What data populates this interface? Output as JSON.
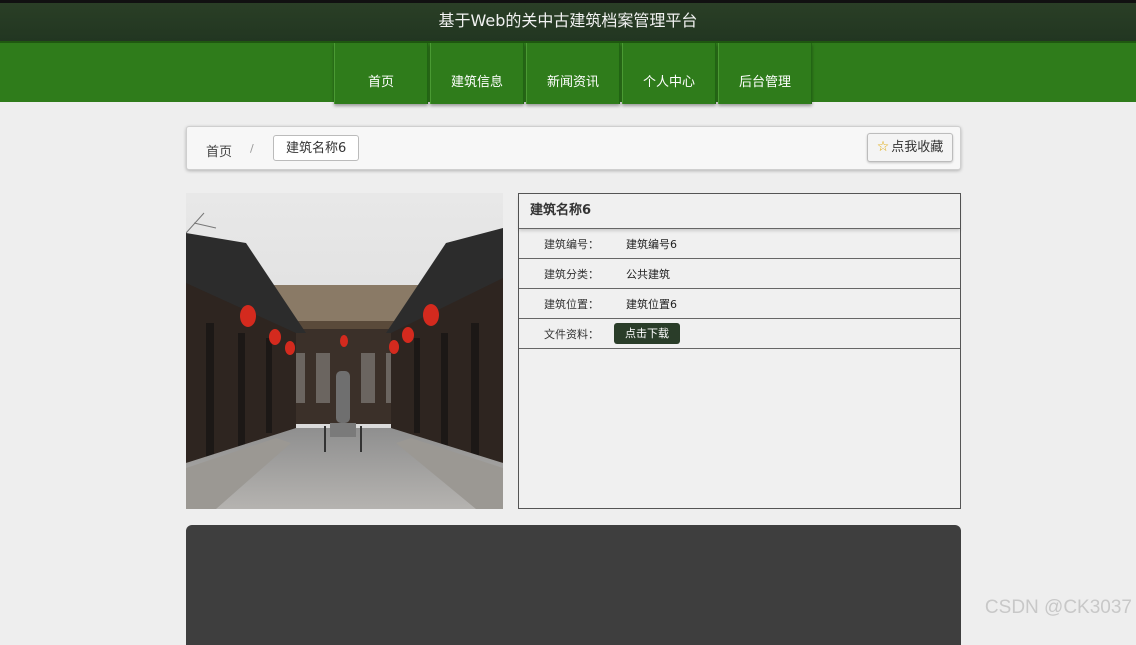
{
  "header": {
    "title": "基于Web的关中古建筑档案管理平台"
  },
  "nav": {
    "items": [
      {
        "label": "首页"
      },
      {
        "label": "建筑信息"
      },
      {
        "label": "新闻资讯"
      },
      {
        "label": "个人中心"
      },
      {
        "label": "后台管理"
      }
    ]
  },
  "breadcrumb": {
    "home": "首页",
    "separator": "/",
    "current": "建筑名称6"
  },
  "favorite": {
    "label": "点我收藏",
    "icon": "star-outline-icon"
  },
  "detail": {
    "title": "建筑名称6",
    "rows": [
      {
        "label": "建筑编号：",
        "value": "建筑编号6"
      },
      {
        "label": "建筑分类：",
        "value": "公共建筑"
      },
      {
        "label": "建筑位置：",
        "value": "建筑位置6"
      }
    ],
    "file": {
      "label": "文件资料：",
      "button": "点击下载"
    }
  },
  "watermark": "CSDN @CK3037",
  "colors": {
    "nav_green": "#2f7c1b",
    "header_dark": "#223621",
    "download_btn": "#2a3d29"
  }
}
